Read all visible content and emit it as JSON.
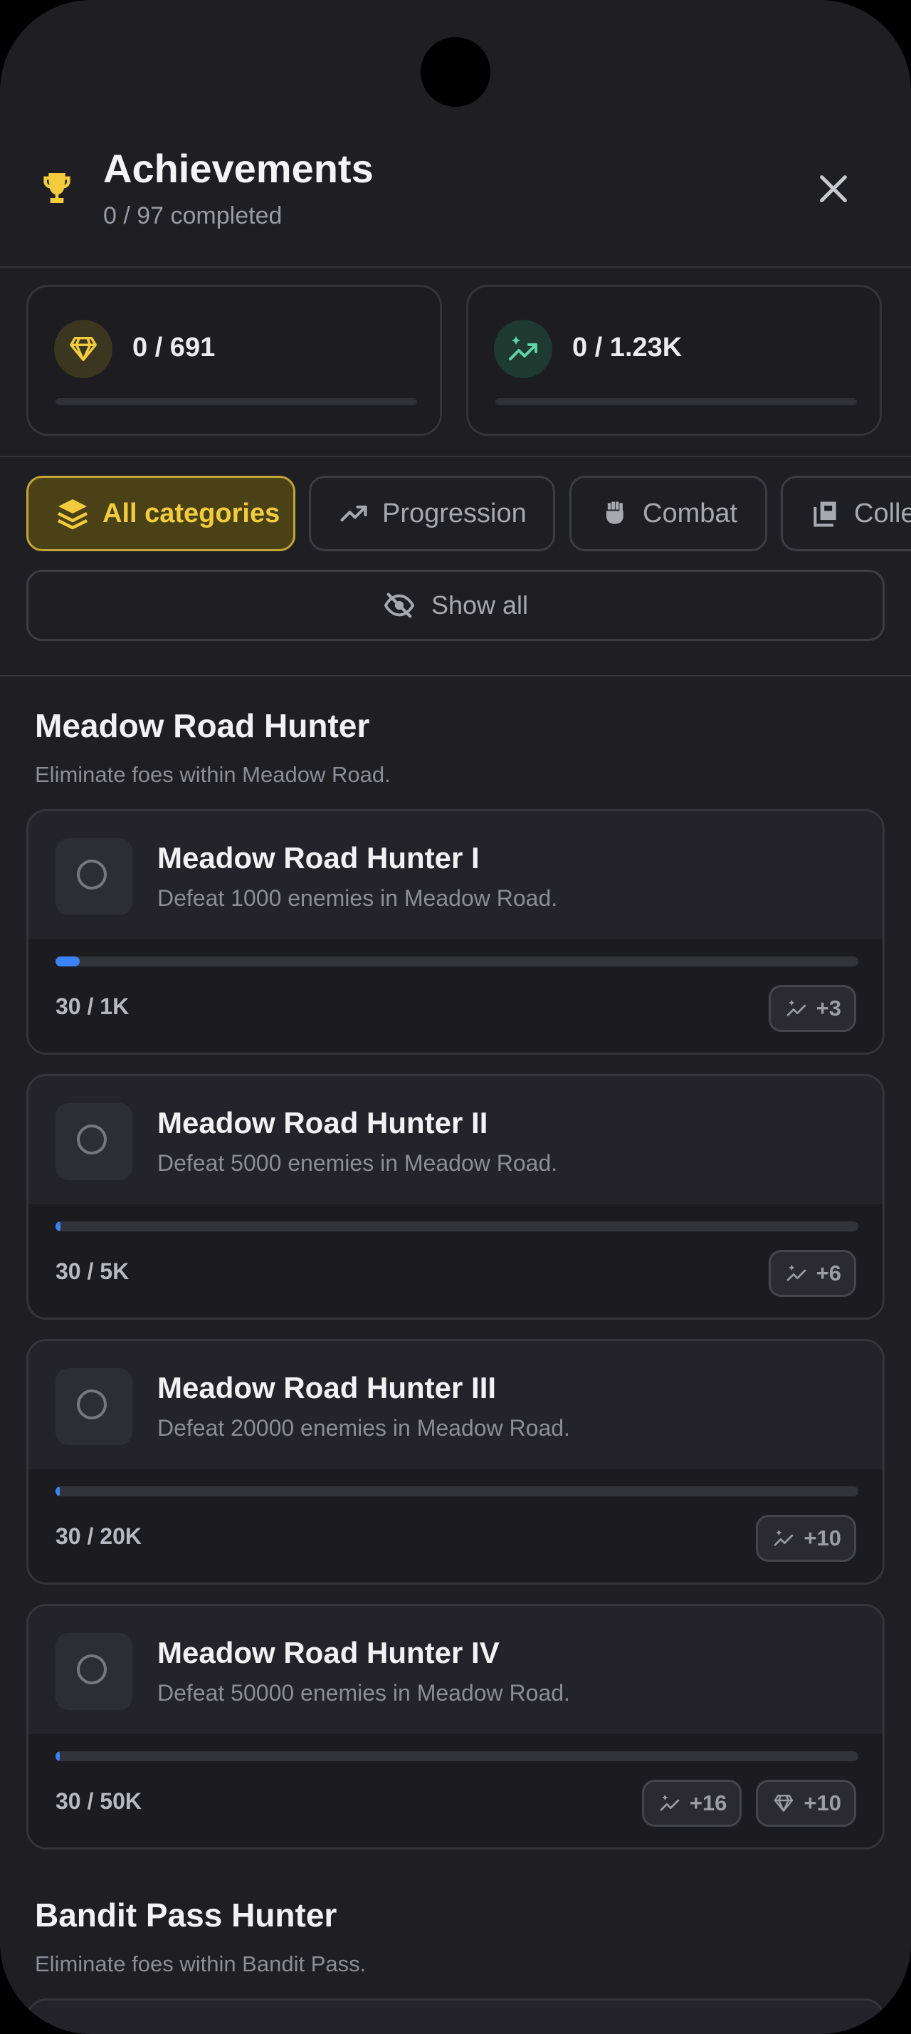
{
  "header": {
    "title": "Achievements",
    "subtitle": "0 / 97 completed"
  },
  "stats": [
    {
      "icon": "gem-icon",
      "value": "0 / 691",
      "progress": 0
    },
    {
      "icon": "sparkle-trend-icon",
      "value": "0 / 1.23K",
      "progress": 0
    }
  ],
  "filters": {
    "chips": [
      {
        "label": "All categories",
        "icon": "layers-icon",
        "active": true
      },
      {
        "label": "Progression",
        "icon": "trending-up-icon",
        "active": false
      },
      {
        "label": "Combat",
        "icon": "fist-icon",
        "active": false
      },
      {
        "label": "Colle",
        "icon": "collection-icon",
        "active": false
      }
    ],
    "show_all": "Show all"
  },
  "sections": [
    {
      "title": "Meadow Road Hunter",
      "description": "Eliminate foes within Meadow Road.",
      "items": [
        {
          "title": "Meadow Road Hunter I",
          "description": "Defeat 1000 enemies in Meadow Road.",
          "progress_text": "30 / 1K",
          "progress": 0.03,
          "rewards": [
            {
              "icon": "sparkle-trend-icon",
              "label": "+3"
            }
          ]
        },
        {
          "title": "Meadow Road Hunter II",
          "description": "Defeat 5000 enemies in Meadow Road.",
          "progress_text": "30 / 5K",
          "progress": 0.006,
          "rewards": [
            {
              "icon": "sparkle-trend-icon",
              "label": "+6"
            }
          ]
        },
        {
          "title": "Meadow Road Hunter III",
          "description": "Defeat 20000 enemies in Meadow Road.",
          "progress_text": "30 / 20K",
          "progress": 0.0015,
          "rewards": [
            {
              "icon": "sparkle-trend-icon",
              "label": "+10"
            }
          ]
        },
        {
          "title": "Meadow Road Hunter IV",
          "description": "Defeat 50000 enemies in Meadow Road.",
          "progress_text": "30 / 50K",
          "progress": 0.0006,
          "rewards": [
            {
              "icon": "sparkle-trend-icon",
              "label": "+16"
            },
            {
              "icon": "gem-icon",
              "label": "+10"
            }
          ]
        }
      ]
    },
    {
      "title": "Bandit Pass Hunter",
      "description": "Eliminate foes within Bandit Pass."
    }
  ],
  "colors": {
    "accent": "#f2cc3c",
    "progress": "#3b82f6",
    "mint": "#5fd3a7"
  }
}
